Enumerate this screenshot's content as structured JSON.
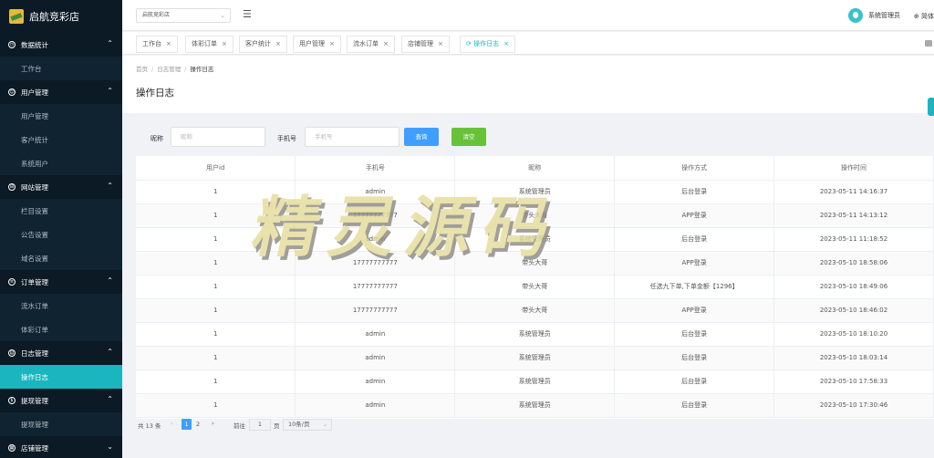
{
  "app": {
    "title": "启航竞彩店"
  },
  "sidebar": {
    "groups": [
      {
        "label": "数据统计",
        "items": [
          "工作台"
        ]
      },
      {
        "label": "用户管理",
        "items": [
          "用户管理",
          "客户统计",
          "系统用户"
        ]
      },
      {
        "label": "网站管理",
        "items": [
          "栏目设置",
          "公告设置",
          "域名设置"
        ]
      },
      {
        "label": "订单管理",
        "items": [
          "流水订单",
          "体彩订单"
        ]
      },
      {
        "label": "日志管理",
        "items": [
          "操作日志"
        ]
      },
      {
        "label": "提现管理",
        "items": [
          "提现管理"
        ]
      },
      {
        "label": "店铺管理",
        "items": []
      }
    ],
    "active_item": "操作日志"
  },
  "topbar": {
    "shop_select": "启航竞彩店",
    "user_name": "系统管理员",
    "lang": "简体"
  },
  "tabs": [
    {
      "label": "工作台",
      "active": false
    },
    {
      "label": "体彩订单",
      "active": false
    },
    {
      "label": "客户统计",
      "active": false
    },
    {
      "label": "用户管理",
      "active": false
    },
    {
      "label": "流水订单",
      "active": false
    },
    {
      "label": "店铺管理",
      "active": false
    },
    {
      "label": "操作日志",
      "active": true
    }
  ],
  "breadcrumb": [
    "首页",
    "日志管理",
    "操作日志"
  ],
  "page_title": "操作日志",
  "filter": {
    "nickname_label": "昵称",
    "nickname_placeholder": "昵称",
    "phone_label": "手机号",
    "phone_placeholder": "手机号",
    "search_label": "查询",
    "clear_label": "清空"
  },
  "table": {
    "columns": [
      "用户id",
      "手机号",
      "昵称",
      "操作方式",
      "操作时间"
    ],
    "rows": [
      [
        "1",
        "admin",
        "系统管理员",
        "后台登录",
        "2023-05-11 14:16:37"
      ],
      [
        "1",
        "17777777777",
        "带头大哥",
        "APP登录",
        "2023-05-11 14:13:12"
      ],
      [
        "1",
        "admin",
        "系统管理员",
        "后台登录",
        "2023-05-11 11:18:52"
      ],
      [
        "1",
        "17777777777",
        "带头大哥",
        "APP登录",
        "2023-05-10 18:58:06"
      ],
      [
        "1",
        "17777777777",
        "带头大哥",
        "任选九下单,下单金额【1296】",
        "2023-05-10 18:49:06"
      ],
      [
        "1",
        "17777777777",
        "带头大哥",
        "APP登录",
        "2023-05-10 18:46:02"
      ],
      [
        "1",
        "admin",
        "系统管理员",
        "后台登录",
        "2023-05-10 18:10:20"
      ],
      [
        "1",
        "admin",
        "系统管理员",
        "后台登录",
        "2023-05-10 18:03:14"
      ],
      [
        "1",
        "admin",
        "系统管理员",
        "后台登录",
        "2023-05-10 17:58:33"
      ],
      [
        "1",
        "admin",
        "系统管理员",
        "后台登录",
        "2023-05-10 17:30:46"
      ]
    ]
  },
  "pagination": {
    "total": "共 13 条",
    "pages": [
      "1",
      "2"
    ],
    "goto_label": "前往",
    "goto_value": "1",
    "page_unit": "页",
    "page_size": "10条/页"
  },
  "watermark": "精灵源码"
}
